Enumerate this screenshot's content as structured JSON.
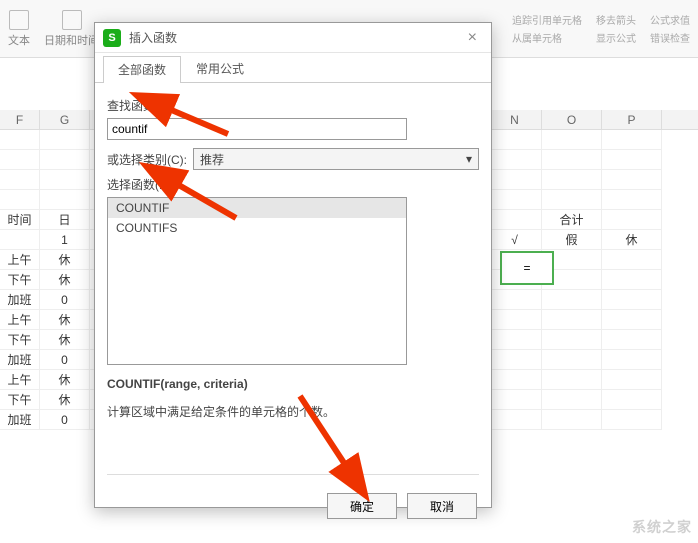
{
  "ribbon": {
    "text_label": "文本",
    "datetime_label": "日期和时间",
    "trace_precedents": "追踪引用单元格",
    "remove_arrows": "移去箭头",
    "formula_eval": "公式求值",
    "show_formula": "显示公式",
    "error_check": "错误检查",
    "cell_depends": "从属单元格"
  },
  "dialog": {
    "title": "插入函数",
    "tabs": {
      "all": "全部函数",
      "common": "常用公式"
    },
    "search_label": "查找函数(S):",
    "search_value": "countif",
    "category_label": "或选择类别(C):",
    "category_value": "推荐",
    "select_label": "选择函数(N):",
    "functions": [
      "COUNTIF",
      "COUNTIFS"
    ],
    "syntax": "COUNTIF(range, criteria)",
    "description": "计算区域中满足给定条件的单元格的个数。",
    "ok": "确定",
    "cancel": "取消"
  },
  "sheet": {
    "columns": [
      "F",
      "G",
      "",
      "",
      "",
      "",
      "",
      "",
      "N",
      "O",
      "P"
    ],
    "rowA": [
      "时间",
      "日",
      "",
      "",
      "",
      "",
      "",
      "",
      "",
      "合计",
      ""
    ],
    "rowB": [
      "",
      "1",
      "",
      "",
      "",
      "",
      "",
      "",
      "√",
      "假",
      "休"
    ],
    "left_rows": [
      [
        "上午",
        "休"
      ],
      [
        "下午",
        "休"
      ],
      [
        "加班",
        "0"
      ],
      [
        "上午",
        "休"
      ],
      [
        "下午",
        "休"
      ],
      [
        "加班",
        "0"
      ],
      [
        "上午",
        "休"
      ],
      [
        "下午",
        "休"
      ],
      [
        "加班",
        "0"
      ]
    ],
    "active_value": "="
  },
  "watermark": "系统之家"
}
